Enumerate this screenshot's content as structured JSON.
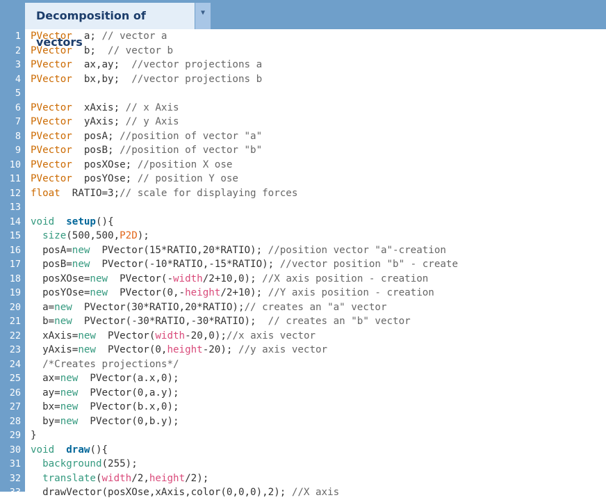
{
  "tab": {
    "title": "Decomposition of vectors"
  },
  "editor": {
    "lines": [
      [
        [
          "kw",
          "PVector"
        ],
        [
          "",
          "  a; "
        ],
        [
          "cm",
          "// vector a"
        ]
      ],
      [
        [
          "kw",
          "PVector"
        ],
        [
          "",
          "  b;  "
        ],
        [
          "cm",
          "// vector b"
        ]
      ],
      [
        [
          "kw",
          "PVector"
        ],
        [
          "",
          "  ax,ay;  "
        ],
        [
          "cm",
          "//vector projections a"
        ]
      ],
      [
        [
          "kw",
          "PVector"
        ],
        [
          "",
          "  bx,by;  "
        ],
        [
          "cm",
          "//vector projections b"
        ]
      ],
      [],
      [
        [
          "kw",
          "PVector"
        ],
        [
          "",
          "  xAxis; "
        ],
        [
          "cm",
          "// x Axis"
        ]
      ],
      [
        [
          "kw",
          "PVector"
        ],
        [
          "",
          "  yAxis; "
        ],
        [
          "cm",
          "// y Axis"
        ]
      ],
      [
        [
          "kw",
          "PVector"
        ],
        [
          "",
          "  posA; "
        ],
        [
          "cm",
          "//position of vector \"a\""
        ]
      ],
      [
        [
          "kw",
          "PVector"
        ],
        [
          "",
          "  posB; "
        ],
        [
          "cm",
          "//position of vector \"b\""
        ]
      ],
      [
        [
          "kw",
          "PVector"
        ],
        [
          "",
          "  posXOse; "
        ],
        [
          "cm",
          "//position X ose"
        ]
      ],
      [
        [
          "kw",
          "PVector"
        ],
        [
          "",
          "  posYOse; "
        ],
        [
          "cm",
          "// position Y ose"
        ]
      ],
      [
        [
          "kw",
          "float"
        ],
        [
          "",
          "  RATIO=3;"
        ],
        [
          "cm",
          "// scale for displaying forces"
        ]
      ],
      [],
      [
        [
          "kf",
          "void"
        ],
        [
          "",
          "  "
        ],
        [
          "fb",
          "setup"
        ],
        [
          "",
          "(){"
        ]
      ],
      [
        [
          "",
          "  "
        ],
        [
          "kf",
          "size"
        ],
        [
          "",
          "(500,500,"
        ],
        [
          "kc",
          "P2D"
        ],
        [
          "",
          ");"
        ]
      ],
      [
        [
          "",
          "  posA="
        ],
        [
          "kf",
          "new"
        ],
        [
          "",
          "  PVector(15*RATIO,20*RATIO); "
        ],
        [
          "cm",
          "//position vector \"a\"-creation"
        ]
      ],
      [
        [
          "",
          "  posB="
        ],
        [
          "kf",
          "new"
        ],
        [
          "",
          "  PVector(-10*RATIO,-15*RATIO); "
        ],
        [
          "cm",
          "//vector position \"b\" - create"
        ]
      ],
      [
        [
          "",
          "  posXOse="
        ],
        [
          "kf",
          "new"
        ],
        [
          "",
          "  PVector(-"
        ],
        [
          "vr",
          "width"
        ],
        [
          "",
          "/2+10,0); "
        ],
        [
          "cm",
          "//X axis position - creation"
        ]
      ],
      [
        [
          "",
          "  posYOse="
        ],
        [
          "kf",
          "new"
        ],
        [
          "",
          "  PVector(0,-"
        ],
        [
          "vr",
          "height"
        ],
        [
          "",
          "/2+10); "
        ],
        [
          "cm",
          "//Y axis position - creation"
        ]
      ],
      [
        [
          "",
          "  a="
        ],
        [
          "kf",
          "new"
        ],
        [
          "",
          "  PVector(30*RATIO,20*RATIO);"
        ],
        [
          "cm",
          "// creates an \"a\" vector"
        ]
      ],
      [
        [
          "",
          "  b="
        ],
        [
          "kf",
          "new"
        ],
        [
          "",
          "  PVector(-30*RATIO,-30*RATIO);  "
        ],
        [
          "cm",
          "// creates an \"b\" vector"
        ]
      ],
      [
        [
          "",
          "  xAxis="
        ],
        [
          "kf",
          "new"
        ],
        [
          "",
          "  PVector("
        ],
        [
          "vr",
          "width"
        ],
        [
          "",
          "-20,0);"
        ],
        [
          "cm",
          "//x axis vector"
        ]
      ],
      [
        [
          "",
          "  yAxis="
        ],
        [
          "kf",
          "new"
        ],
        [
          "",
          "  PVector(0,"
        ],
        [
          "vr",
          "height"
        ],
        [
          "",
          "-20); "
        ],
        [
          "cm",
          "//y axis vector"
        ]
      ],
      [
        [
          "",
          "  "
        ],
        [
          "cm",
          "/*Creates projections*/"
        ]
      ],
      [
        [
          "",
          "  ax="
        ],
        [
          "kf",
          "new"
        ],
        [
          "",
          "  PVector(a.x,0);"
        ]
      ],
      [
        [
          "",
          "  ay="
        ],
        [
          "kf",
          "new"
        ],
        [
          "",
          "  PVector(0,a.y);"
        ]
      ],
      [
        [
          "",
          "  bx="
        ],
        [
          "kf",
          "new"
        ],
        [
          "",
          "  PVector(b.x,0);"
        ]
      ],
      [
        [
          "",
          "  by="
        ],
        [
          "kf",
          "new"
        ],
        [
          "",
          "  PVector(0,b.y);"
        ]
      ],
      [
        [
          "",
          "}"
        ]
      ],
      [
        [
          "kf",
          "void"
        ],
        [
          "",
          "  "
        ],
        [
          "fb",
          "draw"
        ],
        [
          "",
          "(){"
        ]
      ],
      [
        [
          "",
          "  "
        ],
        [
          "kf",
          "background"
        ],
        [
          "",
          "(255);"
        ]
      ],
      [
        [
          "",
          "  "
        ],
        [
          "kf",
          "translate"
        ],
        [
          "",
          "("
        ],
        [
          "vr",
          "width"
        ],
        [
          "",
          "/2,"
        ],
        [
          "vr",
          "height"
        ],
        [
          "",
          "/2);"
        ]
      ],
      [
        [
          "",
          "  drawVector(posXOse,xAxis,color(0,0,0),2); "
        ],
        [
          "cm",
          "//X axis"
        ]
      ]
    ]
  },
  "icons": {
    "tab_menu": "dropdown-triangle-icon"
  }
}
